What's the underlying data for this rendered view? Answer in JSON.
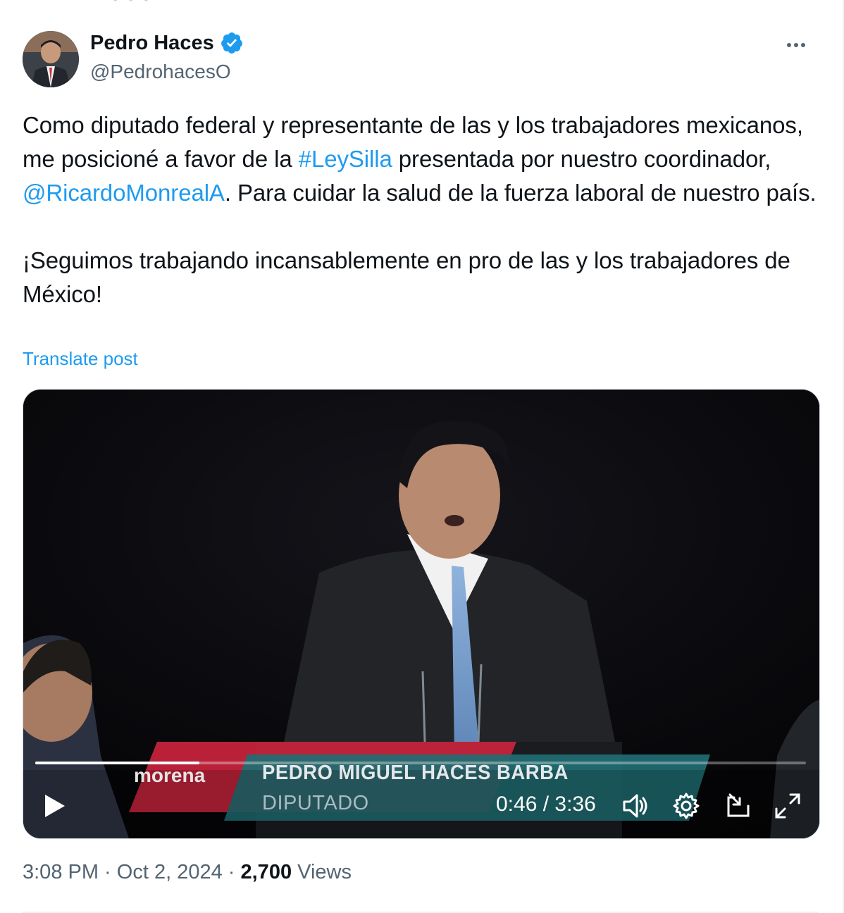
{
  "author": {
    "display_name": "Pedro Haces",
    "handle": "@PedrohacesO",
    "verified": true,
    "avatar_icon": "profile-photo"
  },
  "post": {
    "line1_before": "Como diputado federal y representante de las y los trabajadores mexicanos, me posicioné a favor de la ",
    "hashtag": "#LeySilla",
    "line1_mid": " presentada por nuestro coordinador, ",
    "mention": "@RicardoMonrealA",
    "line1_after": ". Para cuidar la salud de la fuerza laboral de nuestro país.",
    "paragraph2": "¡Seguimos trabajando incansablemente en pro de las y los trabajadores de México!",
    "translate_label": "Translate post"
  },
  "video": {
    "lower_third_party": "morena",
    "lower_third_name": "PEDRO MIGUEL HACES BARBA",
    "lower_third_role": "DIPUTADO",
    "current_time": "0:46",
    "separator": " / ",
    "duration": "3:36",
    "progress_fraction": 0.213,
    "icons": [
      "play-icon",
      "volume-icon",
      "settings-icon",
      "pip-icon",
      "fullscreen-icon"
    ]
  },
  "meta": {
    "time": "3:08 PM",
    "dot": " · ",
    "date": "Oct 2, 2024",
    "views_count": "2,700",
    "views_label": "Views"
  },
  "colors": {
    "link": "#1d9bf0",
    "text": "#0f1419",
    "secondary": "#536471",
    "verified": "#1d9bf0",
    "party_red": "#c8243d",
    "lower_third_teal": "#1f6e73"
  }
}
